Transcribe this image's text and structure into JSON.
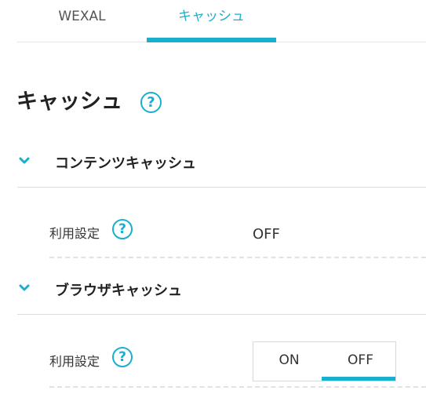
{
  "tabs": [
    {
      "label": "WEXAL",
      "active": false
    },
    {
      "label": "キャッシュ",
      "active": true
    }
  ],
  "page": {
    "title": "キャッシュ",
    "help_symbol": "?"
  },
  "sections": [
    {
      "title": "コンテンツキャッシュ",
      "expanded": true,
      "setting": {
        "label": "利用設定",
        "help_symbol": "?",
        "value": "OFF"
      }
    },
    {
      "title": "ブラウザキャッシュ",
      "expanded": true,
      "setting": {
        "label": "利用設定",
        "help_symbol": "?",
        "options": [
          "ON",
          "OFF"
        ],
        "selected": "OFF"
      }
    }
  ],
  "colors": {
    "accent": "#1aafcf",
    "text": "#333333",
    "border": "#e4e4e4"
  },
  "icons": {
    "help": "question-circle-icon",
    "chevron": "chevron-down-icon"
  }
}
